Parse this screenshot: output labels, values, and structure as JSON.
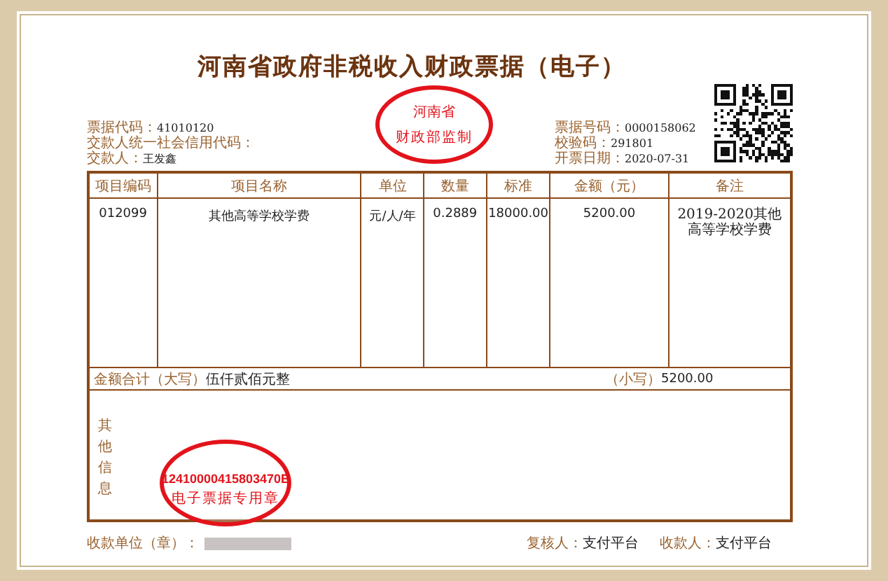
{
  "title": "河南省政府非税收入财政票据（电子）",
  "stamp_top": {
    "region": "河南省",
    "issuer": "财政部监制"
  },
  "info_left": [
    {
      "label": "票据代码：",
      "value": "41010120"
    },
    {
      "label": "交款人统一社会信用代码："
    },
    {
      "label": "交款人：",
      "value": "王发鑫"
    }
  ],
  "info_right": [
    {
      "label": "票据号码：",
      "value": "0000158062"
    },
    {
      "label": "校验码：",
      "value": "291801"
    },
    {
      "label": "开票日期：",
      "value": "2020-07-31"
    }
  ],
  "table": {
    "columns": [
      "项目编码",
      "项目名称",
      "单位",
      "数量",
      "标准",
      "金额（元）",
      "备注"
    ],
    "rows": [
      [
        "012099",
        "其他高等学校学费",
        "元/人/年",
        "0.2889",
        "18000.00",
        "5200.00",
        "2019-2020其他高等学校学费"
      ]
    ]
  },
  "total": {
    "label_upper": "金额合计（大写）",
    "upper": "伍仟贰佰元整",
    "label_lower": "（小写）",
    "lower": "5200.00"
  },
  "other_info": {
    "label": "其他信息"
  },
  "stamp_bottom": {
    "code": "12410000415803470E",
    "name": "电子票据专用章"
  },
  "footer": [
    {
      "label": "收款单位（章）：",
      "redacted": true
    },
    {
      "label": "复核人：",
      "value": "支付平台"
    },
    {
      "label": "收款人：",
      "value": "支付平台"
    }
  ]
}
